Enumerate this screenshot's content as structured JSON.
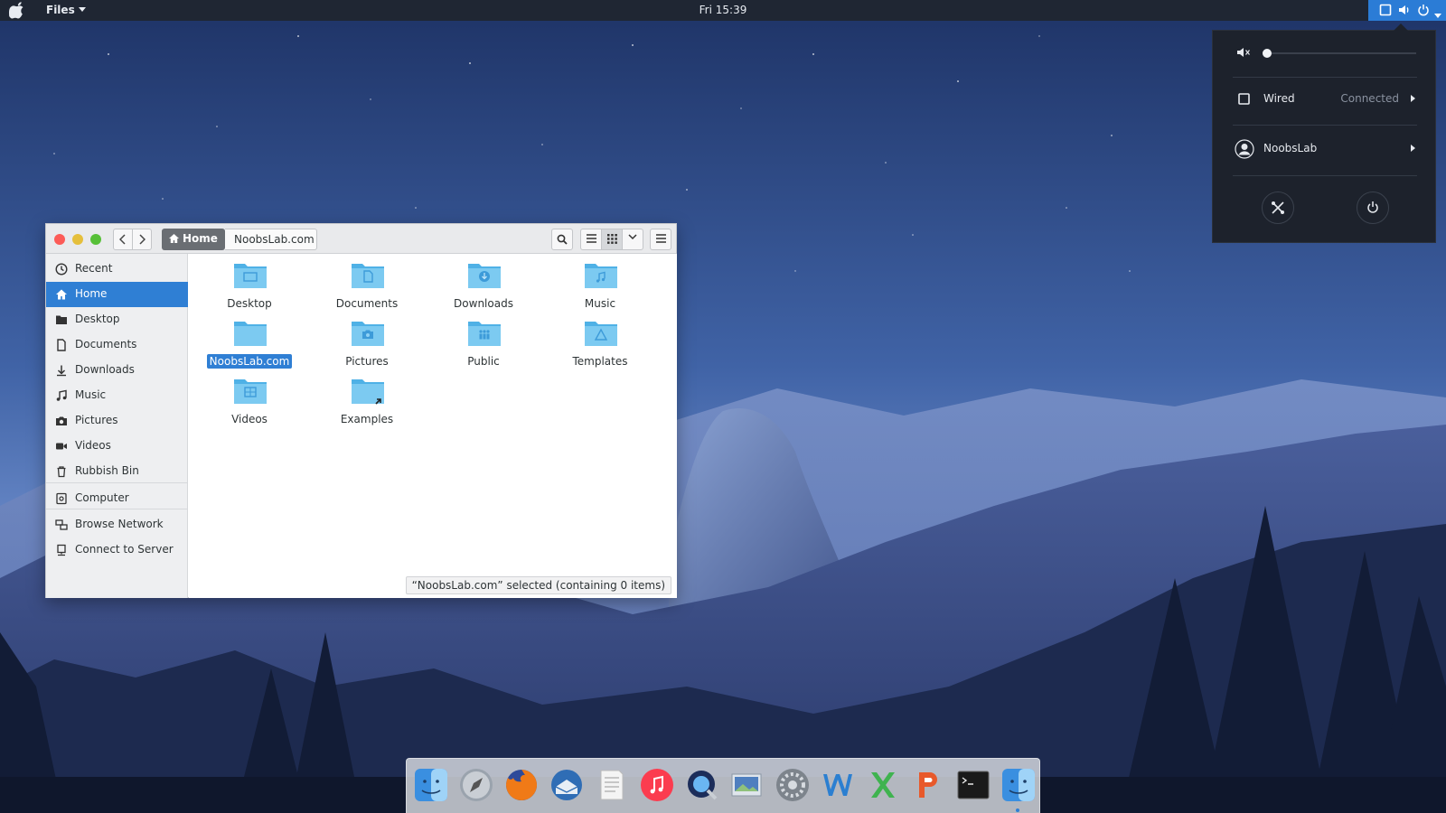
{
  "topbar": {
    "app_menu": "Files",
    "clock": "Fri 15:39"
  },
  "system_menu": {
    "volume_level": 0.0,
    "network": {
      "label": "Wired",
      "status": "Connected"
    },
    "user": {
      "label": "NoobsLab"
    }
  },
  "window": {
    "breadcrumb": {
      "home": "Home",
      "current": "NoobsLab.com"
    },
    "sidebar": {
      "items": [
        {
          "label": "Recent",
          "icon": "clock-icon"
        },
        {
          "label": "Home",
          "icon": "home-icon",
          "active": true
        },
        {
          "label": "Desktop",
          "icon": "folder-icon"
        },
        {
          "label": "Documents",
          "icon": "document-icon"
        },
        {
          "label": "Downloads",
          "icon": "download-icon"
        },
        {
          "label": "Music",
          "icon": "music-icon"
        },
        {
          "label": "Pictures",
          "icon": "camera-icon"
        },
        {
          "label": "Videos",
          "icon": "video-icon"
        },
        {
          "label": "Rubbish Bin",
          "icon": "trash-icon"
        },
        {
          "label": "Computer",
          "icon": "computer-icon"
        },
        {
          "label": "Browse Network",
          "icon": "network-icon"
        },
        {
          "label": "Connect to Server",
          "icon": "server-icon"
        }
      ]
    },
    "files": [
      {
        "name": "Desktop",
        "emblem": "desktop"
      },
      {
        "name": "Documents",
        "emblem": "document"
      },
      {
        "name": "Downloads",
        "emblem": "download"
      },
      {
        "name": "Music",
        "emblem": "music"
      },
      {
        "name": "NoobsLab.com",
        "emblem": "",
        "selected": true
      },
      {
        "name": "Pictures",
        "emblem": "camera"
      },
      {
        "name": "Public",
        "emblem": "people"
      },
      {
        "name": "Templates",
        "emblem": "template"
      },
      {
        "name": "Videos",
        "emblem": "video"
      },
      {
        "name": "Examples",
        "emblem": "link"
      }
    ],
    "status": "“NoobsLab.com” selected  (containing 0 items)"
  },
  "dock": {
    "items": [
      "finder-icon",
      "launchpad-icon",
      "firefox-icon",
      "thunderbird-icon",
      "text-editor-icon",
      "music-player-icon",
      "quicktime-icon",
      "image-viewer-icon",
      "system-preferences-icon",
      "word-icon",
      "spreadsheet-icon",
      "presentation-icon",
      "terminal-icon",
      "files-icon"
    ]
  },
  "colors": {
    "topbar": "#1f2633",
    "accent": "#2f7fd4",
    "folder": "#6cc0ee",
    "menu_bg": "#1d222c",
    "close": "#fc5b57",
    "minimize": "#e5bf3c",
    "maximize": "#57c038"
  }
}
